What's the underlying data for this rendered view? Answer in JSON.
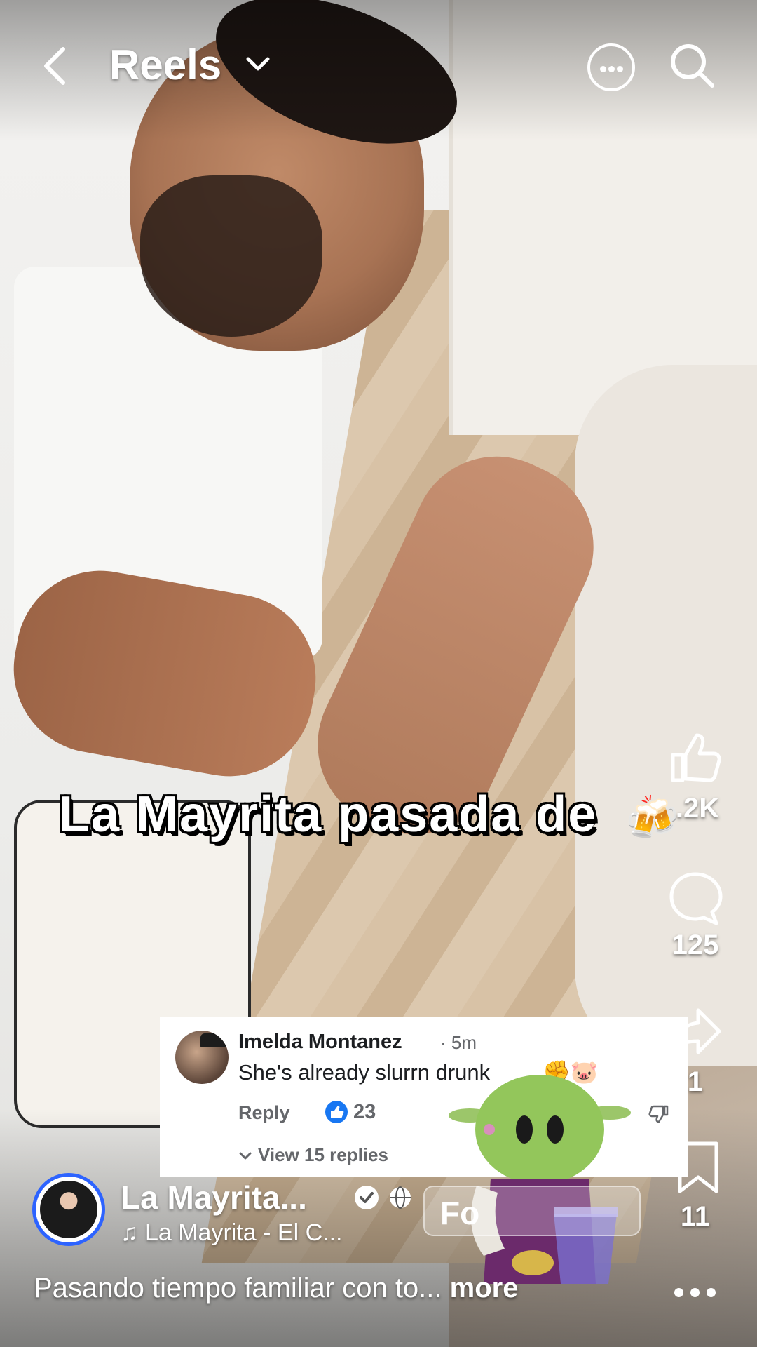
{
  "header": {
    "title": "Reels",
    "back_icon": "back-arrow-icon",
    "dropdown_icon": "chevron-down-icon",
    "more_icon": "more-circle-icon",
    "search_icon": "search-icon"
  },
  "video": {
    "overlay_caption": "La Mayrita pasada de",
    "overlay_emoji": "🍻"
  },
  "actions": {
    "like_count": ".2K",
    "comment_count": "125",
    "share_count": "1",
    "save_count": "11"
  },
  "comment": {
    "author": "Imelda Montanez",
    "time": "· 5m",
    "text": "She's already slurrn drunk",
    "emoji": "✊🐷",
    "reply_label": "Reply",
    "like_count": "23",
    "view_replies": "View 15 replies"
  },
  "account": {
    "name": "La Mayrita...",
    "audio": "La Mayrita - El C...",
    "follow_label": "Fo",
    "description": "Pasando tiempo familiar con to...",
    "more_label": "more"
  },
  "colors": {
    "accent": "#2d63ff",
    "like_blue": "#1877f2",
    "text_white": "#ffffff"
  }
}
